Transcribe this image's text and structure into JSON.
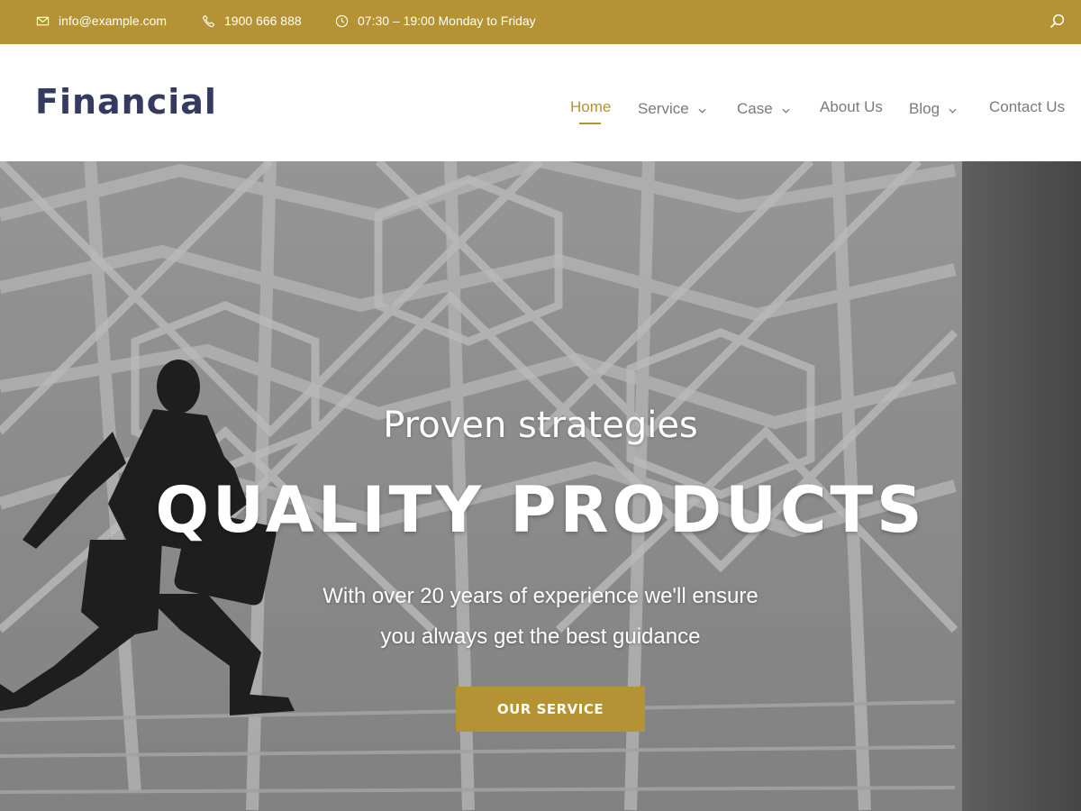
{
  "topbar": {
    "email": "info@example.com",
    "phone": "1900 666 888",
    "hours": "07:30 – 19:00 Monday to Friday",
    "icons": [
      "mail-icon",
      "phone-icon",
      "clock-icon",
      "search-icon"
    ],
    "bg_color": "#b59233"
  },
  "header": {
    "logo": "Financial",
    "nav": [
      {
        "label": "Home",
        "active": true,
        "has_dropdown": false
      },
      {
        "label": "Service",
        "active": false,
        "has_dropdown": true
      },
      {
        "label": "Case",
        "active": false,
        "has_dropdown": true
      },
      {
        "label": "About Us",
        "active": false,
        "has_dropdown": false
      },
      {
        "label": "Blog",
        "active": false,
        "has_dropdown": true
      },
      {
        "label": "Contact Us",
        "active": false,
        "has_dropdown": false
      }
    ]
  },
  "hero": {
    "subtitle": "Proven strategies",
    "title": "QUALITY PRODUCTS",
    "desc_line1": "With over 20 years of experience we'll ensure",
    "desc_line2": "you always get the best guidance",
    "button": "OUR SERVICE"
  },
  "colors": {
    "accent": "#b59233",
    "logo": "#343a60",
    "nav_text": "#7a7a7a"
  }
}
